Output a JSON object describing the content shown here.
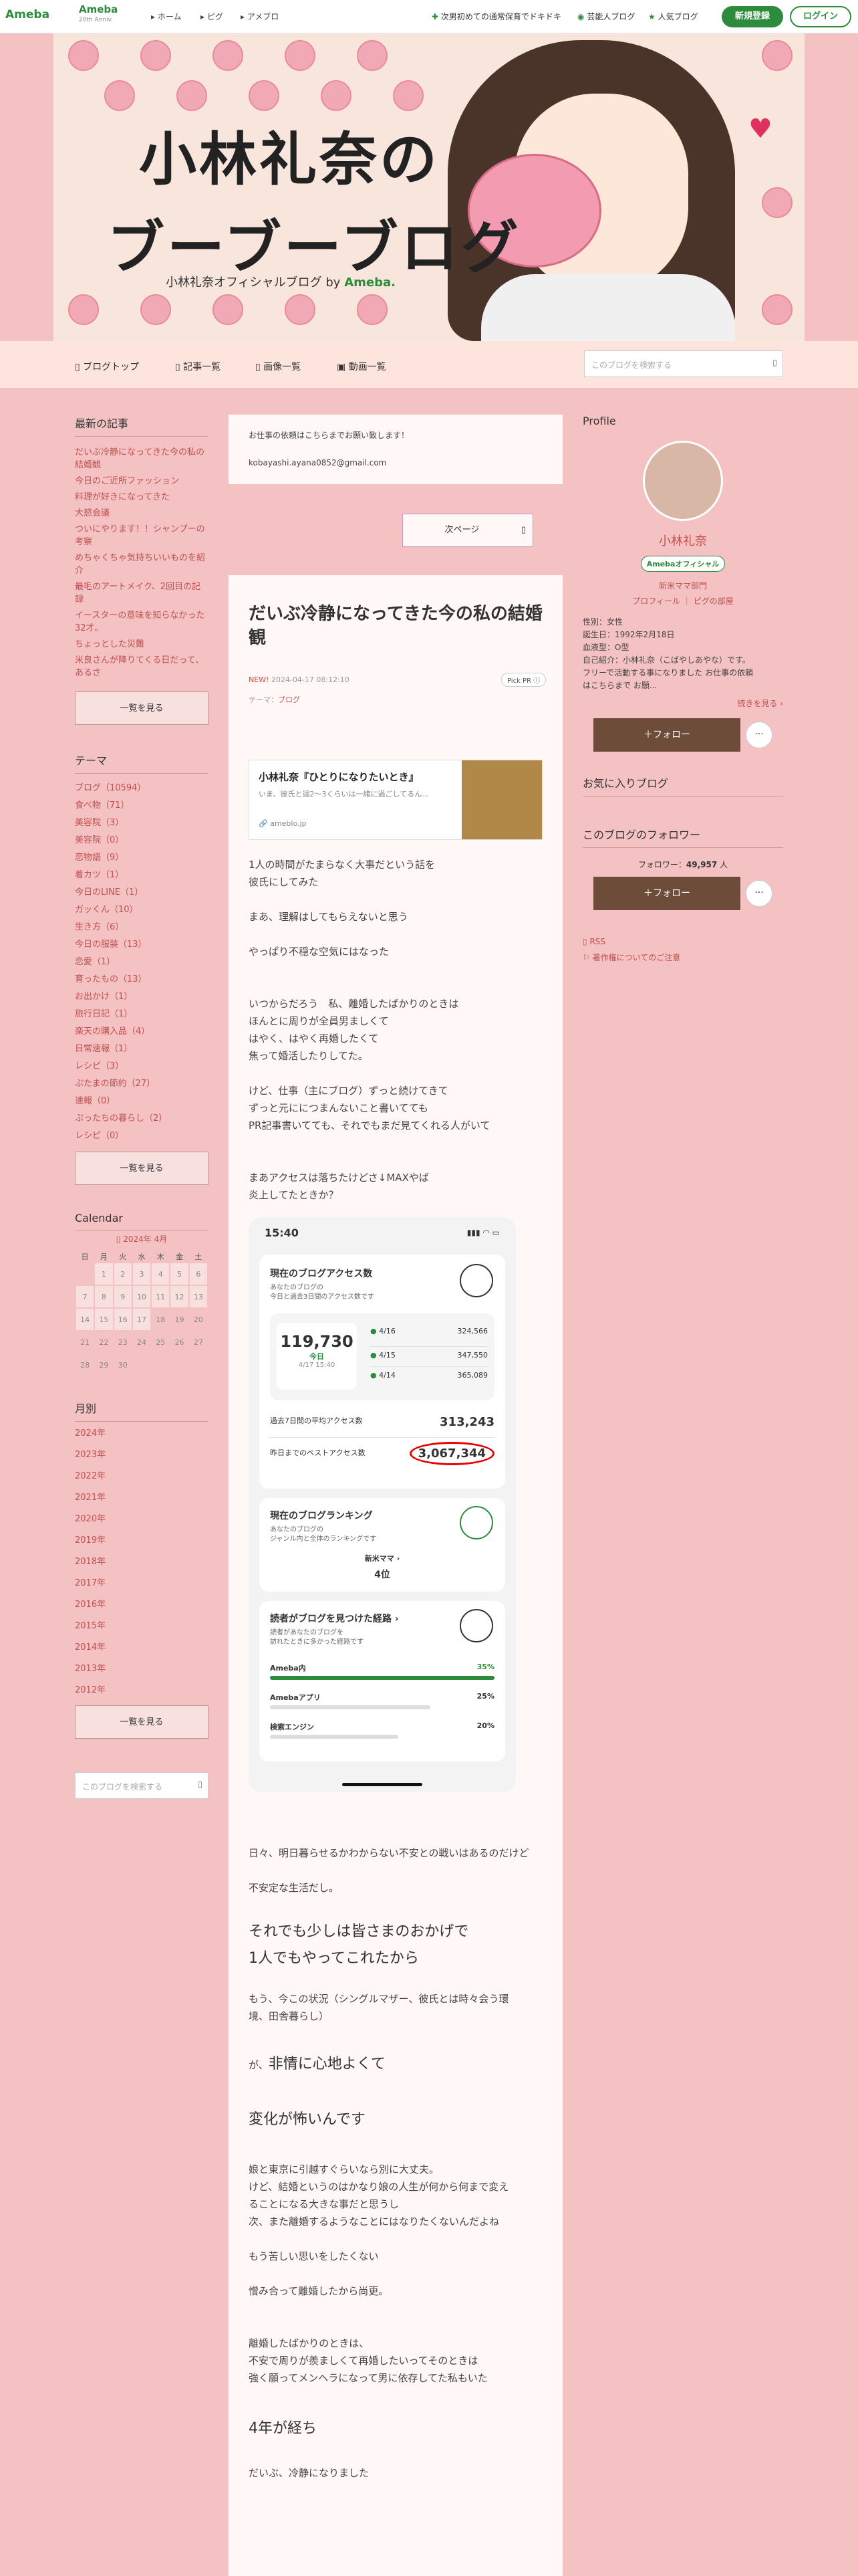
{
  "topbar": {
    "logo": "Ameba",
    "logo20": "Ameba",
    "logo20sub": "20th Anniv.",
    "nav": [
      "ホーム",
      "ピグ",
      "アメブロ"
    ],
    "right": [
      "次男初めての通常保育でドキドキ",
      "芸能人ブログ",
      "人気ブログ"
    ],
    "signup": "新規登録",
    "login": "ログイン"
  },
  "header": {
    "title1": "小林礼奈の",
    "title2": "ブーブーブログ",
    "subtitle": "小林礼奈オフィシャルブログ",
    "by": "by",
    "brand": "Ameba."
  },
  "nav": {
    "links": [
      "ブログトップ",
      "記事一覧",
      "画像一覧",
      "動画一覧"
    ],
    "search_placeholder": "このブログを検索する"
  },
  "left": {
    "recent_h": "最新の記事",
    "recent": [
      "だいぶ冷静になってきた今の私の結婚観",
      "今日のご近所ファッション",
      "料理が好きになってきた",
      "大怒会議",
      "ついにやります！！シャンプーの考察",
      "めちゃくちゃ気持ちいいものを紹介",
      "最毛のアートメイク、2回目の記録",
      "イースターの意味を知らなかった32才。",
      "ちょっとした災難",
      "米良さんが降りてくる日だって、あるさ"
    ],
    "more1": "一覧を見る",
    "theme_h": "テーマ",
    "themes": [
      "ブログ（10594）",
      "食べ物（71）",
      "美容院（3）",
      "美容院（0）",
      "恋物語（9）",
      "着カツ（1）",
      "今日のLINE（1）",
      "ガッくん（10）",
      "生き方（6）",
      "今日の服装（13）",
      "恋愛（1）",
      "育ったもの（13）",
      "お出かけ（1）",
      "旅行日記（1）",
      "楽天の購入品（4）",
      "日常速報（1）",
      "レシピ（3）",
      "ぷたまの節約（27）",
      "速報（0）",
      "ぷったちの暮らし（2）",
      "レシピ（0）"
    ],
    "more2": "一覧を見る",
    "cal_h": "Calendar",
    "cal_month": "2024年 4月",
    "cal_days": [
      "日",
      "月",
      "火",
      "水",
      "木",
      "金",
      "土"
    ],
    "cal_rows": [
      [
        "",
        "1",
        "2",
        "3",
        "4",
        "5",
        "6"
      ],
      [
        "7",
        "8",
        "9",
        "10",
        "11",
        "12",
        "13"
      ],
      [
        "14",
        "15",
        "16",
        "17",
        "18",
        "19",
        "20"
      ],
      [
        "21",
        "22",
        "23",
        "24",
        "25",
        "26",
        "27"
      ],
      [
        "28",
        "29",
        "30",
        "",
        "",
        "",
        ""
      ]
    ],
    "month_h": "月別",
    "months": [
      "2024年",
      "2023年",
      "2022年",
      "2021年",
      "2020年",
      "2019年",
      "2018年",
      "2017年",
      "2016年",
      "2015年",
      "2014年",
      "2013年",
      "2012年"
    ],
    "more3": "一覧を見る",
    "search_placeholder": "このブログを検索する"
  },
  "main": {
    "notice1": "お仕事の依頼はこちらまでお願い致します！",
    "notice2": "kobayashi.ayana0852@gmail.com",
    "next": "次ページ",
    "title": "だいぶ冷静になってきた今の私の結婚観",
    "new": "NEW!",
    "date": "2024-04-17 08:12:10",
    "pick": "Pick PR",
    "theme_label": "テーマ：",
    "theme": "ブログ",
    "embed_title": "小林礼奈『ひとりになりたいとき』",
    "embed_desc": "いま、彼氏と週2〜3くらいは一緒に過ごしてるん...",
    "embed_src": "ameblo.jp",
    "p1": "1人の時間がたまらなく大事だという話を",
    "p1b": "彼氏にしてみた",
    "p2": "まあ、理解はしてもらえないと思う",
    "p3": "やっぱり不穏な空気にはなった",
    "p4": [
      "いつからだろう　私、離婚したばかりのときは",
      "ほんとに周りが全員男ましくて",
      "はやく、はやく再婚したくて",
      "焦って婚活したりしてた。"
    ],
    "p5": [
      "けど、仕事（主にブログ）ずっと続けてきて",
      "ずっと元ににつまんないこと書いてても",
      "PR記事書いてても、それでもまだ見てくれる人がいて"
    ],
    "p6": [
      "まあアクセスは落ちたけどさ↓MAXやば",
      "炎上してたときか？"
    ],
    "shot": {
      "time": "15:40",
      "access_h": "現在のブログアクセス数",
      "access_sub1": "あなたのブログの",
      "access_sub2": "今日と過去3日間のアクセス数です",
      "today_num": "119,730",
      "today_label": "今日",
      "today_time": "4/17 15:40",
      "rows": [
        [
          "4/16",
          "324,566"
        ],
        [
          "4/15",
          "347,550"
        ],
        [
          "4/14",
          "365,089"
        ]
      ],
      "avg_label": "過去7日間の平均アクセス数",
      "avg": "313,243",
      "best_label": "昨日までのベストアクセス数",
      "best": "3,067,344",
      "rank_h": "現在のブログランキング",
      "rank_sub1": "あなたのブログの",
      "rank_sub2": "ジャンル内と全体のランキングです",
      "genre": "新米ママ",
      "rank": "4位",
      "route_h": "読者がブログを見つけた経路",
      "route_sub1": "読者があなたのブログを",
      "route_sub2": "訪れたときに多かった経路です",
      "routes": [
        [
          "Ameba内",
          "35%"
        ],
        [
          "Amebaアプリ",
          "25%"
        ],
        [
          "検索エンジン",
          "20%"
        ]
      ]
    },
    "p7": "日々、明日暮らせるかわからない不安との戦いはあるのだけど",
    "p8": "不安定な生活だし。",
    "h1a": "それでも少しは皆さまのおかげで",
    "h1b": "1人でもやってこれたから",
    "p9": [
      "もう、今この状況（シングルマザー、彼氏とは時々会う環",
      "境、田舎暮らし）"
    ],
    "h2pre": "が、",
    "h2": "非情に心地よくて",
    "h3": "変化が怖いんです",
    "p10": [
      "娘と東京に引越すぐらいなら別に大丈夫。",
      "けど、結婚というのはかなり娘の人生が何から何まで変え",
      "ることになる大きな事だと思うし",
      "次、また離婚するようなことにはなりたくないんだよね"
    ],
    "p11": "もう苦しい思いをしたくない",
    "p12": "憎み合って離婚したから尚更。",
    "p13": [
      "離婚したばかりのときは、",
      "不安で周りが羨ましくて再婚したいってそのときは",
      "強く願ってメンヘラになって男に依存してた私もいた"
    ],
    "h4": "4年が経ち",
    "p14": "だいぶ、冷静になりました"
  },
  "right": {
    "profile_h": "Profile",
    "name": "小林礼奈",
    "official": "Amebaオフィシャル",
    "genre": "新米ママ部門",
    "links": [
      "プロフィール",
      "ピグの部屋"
    ],
    "info": [
      "性別：女性",
      "誕生日：1992年2月18日",
      "血液型：O型",
      "自己紹介：小林礼奈（こばやしあやな）です。",
      "フリーで活動する事になりました お仕事の依頼",
      "はこちらまで お願..."
    ],
    "more": "続きを見る",
    "follow": "＋フォロー",
    "dots": "···",
    "fav_h": "お気に入りブログ",
    "followers_h": "このブログのフォロワー",
    "followers_label": "フォロワー：",
    "followers_count": "49,957",
    "followers_unit": "人",
    "follow2": "＋フォロー",
    "rss": "RSS",
    "copyright": "著作権についてのご注意"
  }
}
